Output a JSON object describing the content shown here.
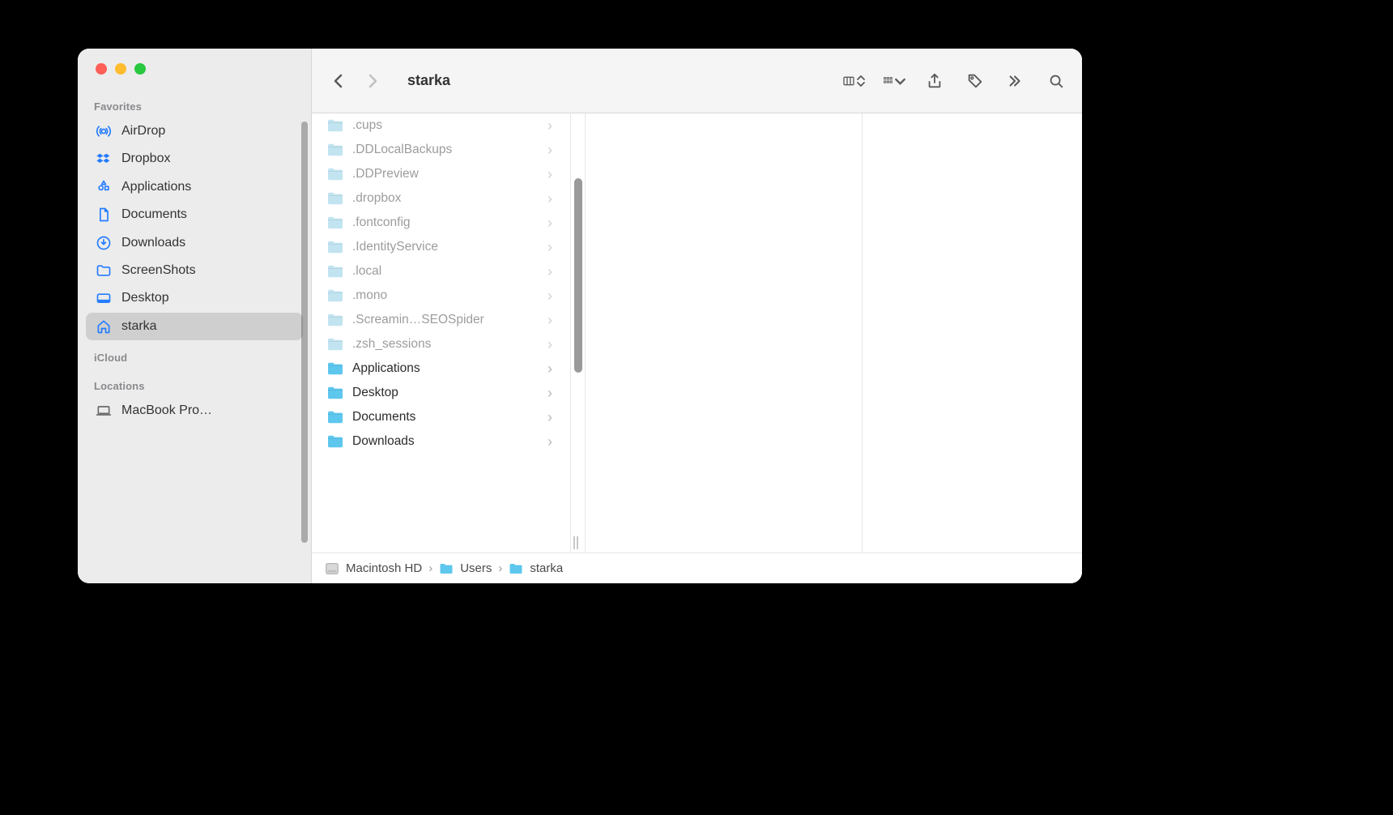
{
  "window": {
    "title": "starka"
  },
  "toolbar": {
    "back_enabled": true,
    "forward_enabled": false
  },
  "sidebar": {
    "sections": [
      {
        "title": "Favorites",
        "items": [
          {
            "icon": "airdrop-icon",
            "label": "AirDrop",
            "selected": false
          },
          {
            "icon": "dropbox-icon",
            "label": "Dropbox",
            "selected": false
          },
          {
            "icon": "applications-icon",
            "label": "Applications",
            "selected": false
          },
          {
            "icon": "documents-icon",
            "label": "Documents",
            "selected": false
          },
          {
            "icon": "downloads-icon",
            "label": "Downloads",
            "selected": false
          },
          {
            "icon": "screenshots-icon",
            "label": "ScreenShots",
            "selected": false
          },
          {
            "icon": "desktop-icon",
            "label": "Desktop",
            "selected": false
          },
          {
            "icon": "home-icon",
            "label": "starka",
            "selected": true
          }
        ]
      },
      {
        "title": "iCloud",
        "items": []
      },
      {
        "title": "Locations",
        "items": [
          {
            "icon": "laptop-icon",
            "label": "MacBook Pro…",
            "selected": false
          }
        ]
      }
    ]
  },
  "column1": {
    "entries": [
      {
        "label": ".cups",
        "hidden": true
      },
      {
        "label": ".DDLocalBackups",
        "hidden": true
      },
      {
        "label": ".DDPreview",
        "hidden": true
      },
      {
        "label": ".dropbox",
        "hidden": true
      },
      {
        "label": ".fontconfig",
        "hidden": true
      },
      {
        "label": ".IdentityService",
        "hidden": true
      },
      {
        "label": ".local",
        "hidden": true
      },
      {
        "label": ".mono",
        "hidden": true
      },
      {
        "label": ".Screamin…SEOSpider",
        "hidden": true
      },
      {
        "label": ".zsh_sessions",
        "hidden": true
      },
      {
        "label": "Applications",
        "hidden": false
      },
      {
        "label": "Desktop",
        "hidden": false
      },
      {
        "label": "Documents",
        "hidden": false
      },
      {
        "label": "Downloads",
        "hidden": false
      }
    ]
  },
  "pathbar": [
    {
      "icon": "hdd-icon",
      "label": "Macintosh HD"
    },
    {
      "icon": "folder-icon",
      "label": "Users"
    },
    {
      "icon": "folder-icon",
      "label": "starka"
    }
  ],
  "icons": {
    "chevron_right": "›"
  },
  "colors": {
    "accent_blue": "#247cff",
    "folder_normal": "#5ec7ee",
    "folder_hidden": "#c2e4f1"
  }
}
